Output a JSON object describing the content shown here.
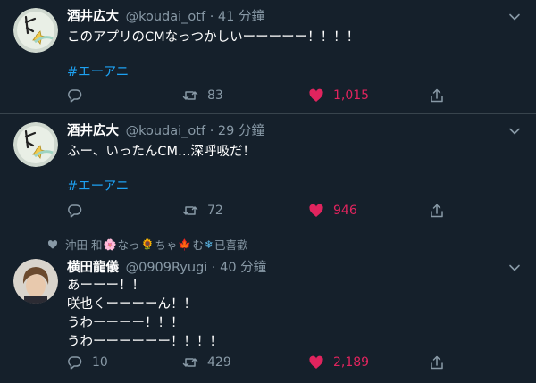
{
  "tweets": [
    {
      "name": "酒井広大",
      "handle": "@koudai_otf · 41 分鐘",
      "lines": [
        "このアプリのCMなっつかしいーーーーー！！！！"
      ],
      "hashtag": "#エーアニ",
      "reply_count": "",
      "retweet_count": "83",
      "like_count": "1,015",
      "liked": true
    },
    {
      "name": "酒井広大",
      "handle": "@koudai_otf · 29 分鐘",
      "lines": [
        "ふー、いったんCM…深呼吸だ！"
      ],
      "hashtag": "#エーアニ",
      "reply_count": "",
      "retweet_count": "72",
      "like_count": "946",
      "liked": true
    },
    {
      "social_context": {
        "prefix": "沖田 和 ",
        "emoji1": "🌸",
        "mid1": "なっ",
        "emoji2": "🌻",
        "mid2": "ちゃ",
        "emoji3": "🍁",
        "mid3": "む",
        "emoji4": "❄",
        "suffix": " 已喜歡"
      },
      "name": "横田龍儀",
      "handle": "@0909Ryugi · 40 分鐘",
      "lines": [
        "あーーー！！",
        "咲也くーーーーん！！",
        "うわーーーー！！！",
        "うわーーーーーー！！！！"
      ],
      "reply_count": "10",
      "retweet_count": "429",
      "like_count": "2,189",
      "liked": true
    }
  ],
  "colors": {
    "background": "#15202b",
    "divider": "#38444d",
    "secondary_text": "#8899a6",
    "hashtag": "#1da1f2",
    "like": "#e0245e"
  },
  "icons": [
    "reply-icon",
    "retweet-icon",
    "heart-icon",
    "share-icon",
    "chevron-down-icon"
  ]
}
